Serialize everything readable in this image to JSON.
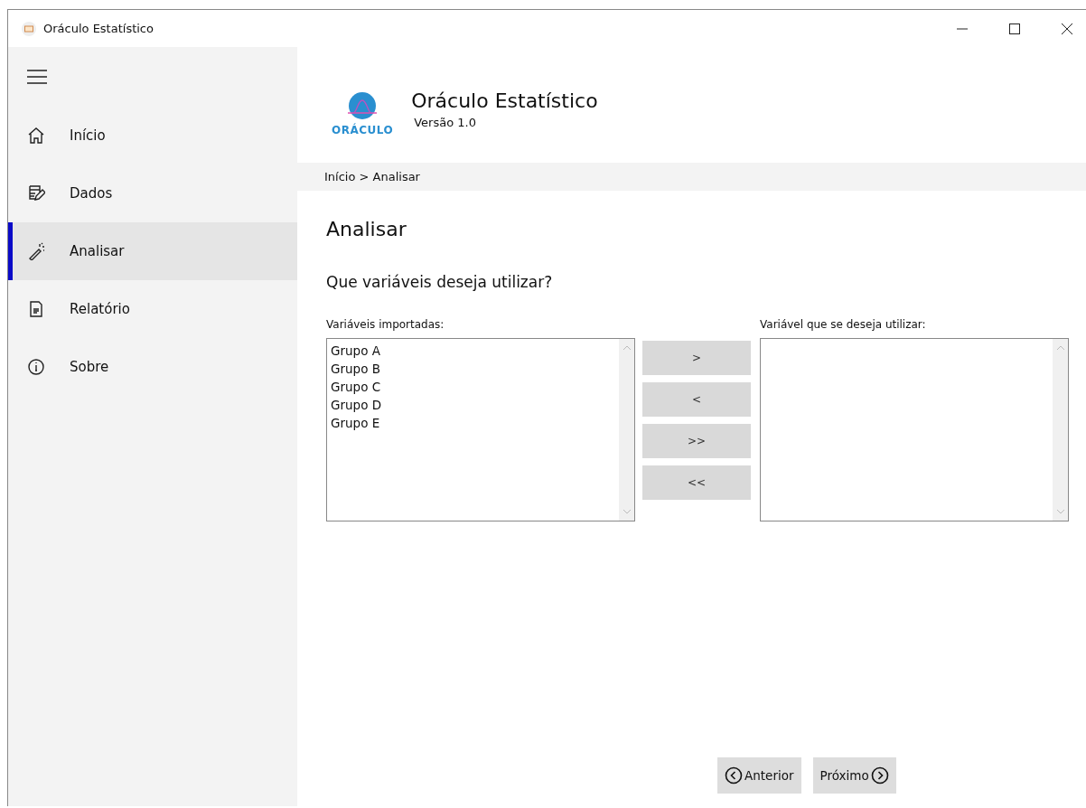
{
  "window": {
    "title": "Oráculo Estatístico"
  },
  "sidebar": {
    "items": [
      {
        "label": "Início",
        "kind": "home",
        "selected": false
      },
      {
        "label": "Dados",
        "kind": "data",
        "selected": false
      },
      {
        "label": "Analisar",
        "kind": "wand",
        "selected": true
      },
      {
        "label": "Relatório",
        "kind": "document",
        "selected": false
      },
      {
        "label": "Sobre",
        "kind": "info",
        "selected": false
      }
    ]
  },
  "header": {
    "logo_text": "ORÁCULO",
    "title": "Oráculo Estatístico",
    "version": "Versão 1.0"
  },
  "breadcrumb": "Início > Analisar",
  "page_title": "Analisar",
  "question": "Que variáveis deseja utilizar?",
  "source_list": {
    "label": "Variáveis importadas:",
    "items": [
      "Grupo A",
      "Grupo B",
      "Grupo C",
      "Grupo D",
      "Grupo E"
    ]
  },
  "transfer_buttons": [
    ">",
    "<",
    ">>",
    "<<"
  ],
  "target_list": {
    "label": "Variável que se deseja utilizar:"
  },
  "nav_buttons": [
    {
      "label": "Anterior",
      "kind": "back"
    },
    {
      "label": "Próximo",
      "kind": "next"
    }
  ]
}
